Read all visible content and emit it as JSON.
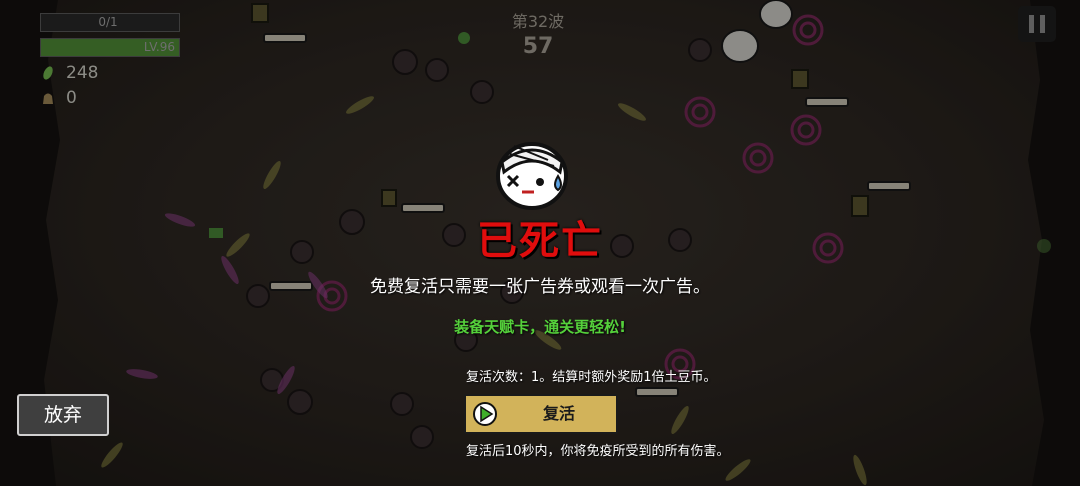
{
  "hud": {
    "hp_text": "0/1",
    "hp_fraction": 0,
    "level_text": "LV.96",
    "xp_fraction": 1.0,
    "materials_count": "248",
    "bag_count": "0",
    "wave_label": "第32波",
    "wave_timer": "57"
  },
  "death_dialog": {
    "title": "已死亡",
    "description": "免费复活只需要一张广告券或观看一次广告。",
    "talent_tip": "装备天赋卡，通关更轻松!",
    "revive_count_text": "复活次数：1。结算时额外奖励1倍土豆币。",
    "revive_button_label": "复活",
    "immunity_note": "复活后10秒内，你将免疫所受到的所有伤害。"
  },
  "give_up_label": "放弃",
  "colors": {
    "title_red": "#e00d0d",
    "tip_green": "#55d13b",
    "revive_button_gold": "#d2b35a",
    "xp_green": "#355e24",
    "background": "#2c2621"
  },
  "icons": {
    "materials": "green-leaf-icon",
    "bag": "bag-icon",
    "pause": "pause-icon",
    "revive_play": "play-circle-icon",
    "character": "bandaged-dead-potato-icon"
  }
}
